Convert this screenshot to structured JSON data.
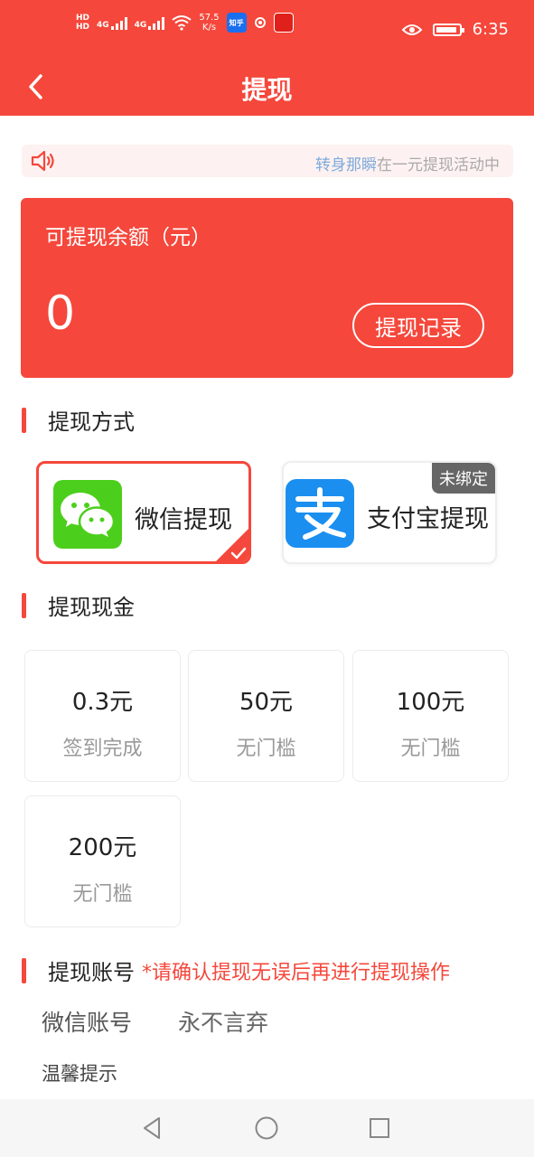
{
  "status_bar": {
    "hd1": "HD",
    "hd2": "HD",
    "net1": "4G",
    "net2": "4G",
    "speed_value": "57.5",
    "speed_unit": "K/s",
    "app1": "知乎",
    "time": "6:35"
  },
  "header": {
    "title": "提现"
  },
  "notice": {
    "highlight": "转身那瞬",
    "text": "在一元提现活动中"
  },
  "balance": {
    "label": "可提现余额（元）",
    "value": "0",
    "record_button": "提现记录"
  },
  "methods_section": {
    "title": "提现方式",
    "wechat_label": "微信提现",
    "alipay_label": "支付宝提现",
    "alipay_badge": "未绑定"
  },
  "amount_section": {
    "title": "提现现金",
    "options": [
      {
        "value": "0.3元",
        "note": "签到完成"
      },
      {
        "value": "50元",
        "note": "无门槛"
      },
      {
        "value": "100元",
        "note": "无门槛"
      },
      {
        "value": "200元",
        "note": "无门槛"
      }
    ]
  },
  "account_section": {
    "title": "提现账号",
    "note": "*请确认提现无误后再进行提现操作",
    "account_label": "微信账号",
    "account_value": "永不言弃",
    "tip_label": "温馨提示"
  },
  "colors": {
    "brand": "#f5473b",
    "wechat": "#4ccf1c",
    "alipay": "#1a8ff0"
  }
}
